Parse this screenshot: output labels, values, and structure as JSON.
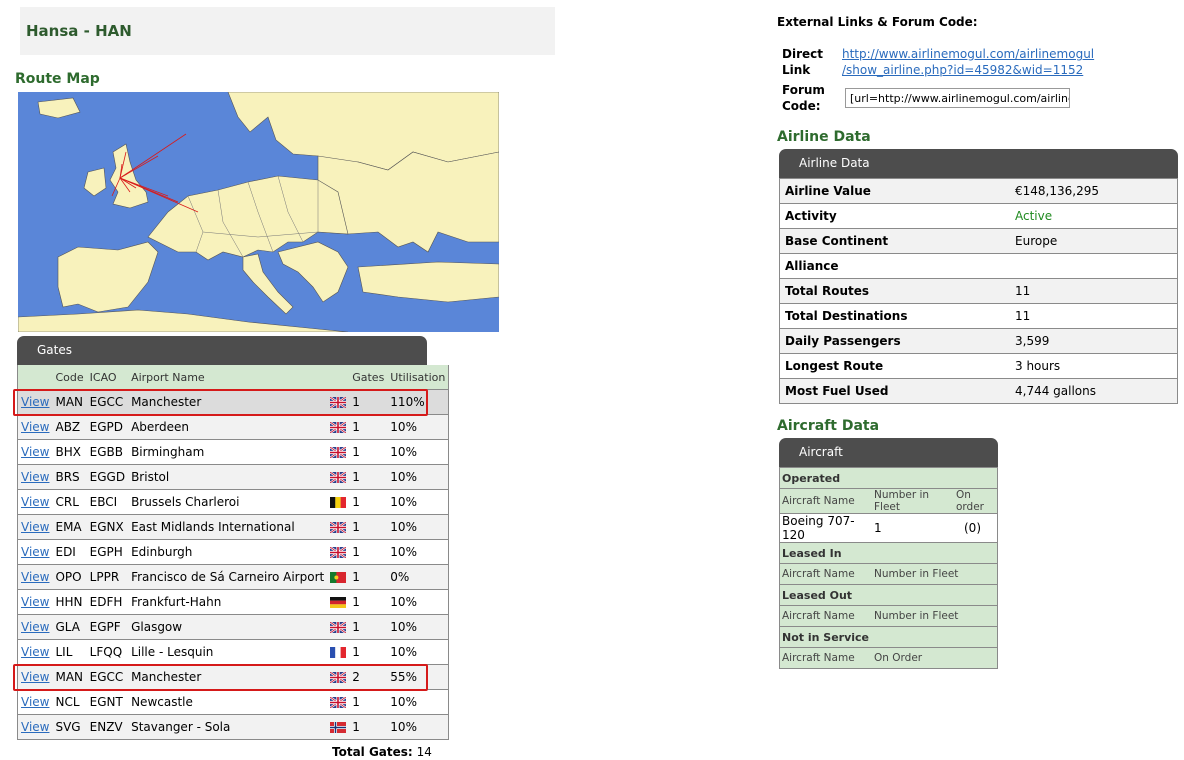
{
  "header": {
    "title": "Hansa - HAN"
  },
  "route_map": {
    "heading": "Route Map"
  },
  "gates": {
    "panel_title": "Gates",
    "columns": {
      "view": "",
      "code": "Code",
      "icao": "ICAO",
      "airport": "Airport Name",
      "flag": "",
      "gates": "Gates",
      "util": "Utilisation"
    },
    "rows": [
      {
        "view": "View",
        "code": "MAN",
        "icao": "EGCC",
        "airport": "Manchester",
        "flag": "uk-flag-icon",
        "gates": "1",
        "util": "110%"
      },
      {
        "view": "View",
        "code": "ABZ",
        "icao": "EGPD",
        "airport": "Aberdeen",
        "flag": "uk-flag-icon",
        "gates": "1",
        "util": "10%"
      },
      {
        "view": "View",
        "code": "BHX",
        "icao": "EGBB",
        "airport": "Birmingham",
        "flag": "uk-flag-icon",
        "gates": "1",
        "util": "10%"
      },
      {
        "view": "View",
        "code": "BRS",
        "icao": "EGGD",
        "airport": "Bristol",
        "flag": "uk-flag-icon",
        "gates": "1",
        "util": "10%"
      },
      {
        "view": "View",
        "code": "CRL",
        "icao": "EBCI",
        "airport": "Brussels Charleroi",
        "flag": "belgium-flag-icon",
        "gates": "1",
        "util": "10%"
      },
      {
        "view": "View",
        "code": "EMA",
        "icao": "EGNX",
        "airport": "East Midlands International",
        "flag": "uk-flag-icon",
        "gates": "1",
        "util": "10%"
      },
      {
        "view": "View",
        "code": "EDI",
        "icao": "EGPH",
        "airport": "Edinburgh",
        "flag": "uk-flag-icon",
        "gates": "1",
        "util": "10%"
      },
      {
        "view": "View",
        "code": "OPO",
        "icao": "LPPR",
        "airport": "Francisco de Sá Carneiro Airport",
        "flag": "portugal-flag-icon",
        "gates": "1",
        "util": "0%"
      },
      {
        "view": "View",
        "code": "HHN",
        "icao": "EDFH",
        "airport": "Frankfurt-Hahn",
        "flag": "germany-flag-icon",
        "gates": "1",
        "util": "10%"
      },
      {
        "view": "View",
        "code": "GLA",
        "icao": "EGPF",
        "airport": "Glasgow",
        "flag": "uk-flag-icon",
        "gates": "1",
        "util": "10%"
      },
      {
        "view": "View",
        "code": "LIL",
        "icao": "LFQQ",
        "airport": "Lille - Lesquin",
        "flag": "france-flag-icon",
        "gates": "1",
        "util": "10%"
      },
      {
        "view": "View",
        "code": "MAN",
        "icao": "EGCC",
        "airport": "Manchester",
        "flag": "uk-flag-icon",
        "gates": "2",
        "util": "55%"
      },
      {
        "view": "View",
        "code": "NCL",
        "icao": "EGNT",
        "airport": "Newcastle",
        "flag": "uk-flag-icon",
        "gates": "1",
        "util": "10%"
      },
      {
        "view": "View",
        "code": "SVG",
        "icao": "ENZV",
        "airport": "Stavanger - Sola",
        "flag": "norway-flag-icon",
        "gates": "1",
        "util": "10%"
      }
    ],
    "total_label": "Total Gates:",
    "total_value": "14"
  },
  "external": {
    "heading": "External Links & Forum Code:",
    "direct_label_1": "Direct",
    "direct_label_2": "Link",
    "link_line_1": "http://www.airlinemogul.com/airlinemogul",
    "link_line_2": "/show_airline.php?id=45982&wid=1152",
    "forum_label_1": "Forum",
    "forum_label_2": "Code:",
    "forum_value": "[url=http://www.airlinemogul.com/airlinemogu"
  },
  "airline_data": {
    "heading": "Airline Data",
    "panel_title": "Airline Data",
    "rows": [
      {
        "label": "Airline Value",
        "value": "€148,136,295"
      },
      {
        "label": "Activity",
        "value": "Active"
      },
      {
        "label": "Base Continent",
        "value": "Europe"
      },
      {
        "label": "Alliance",
        "value": ""
      },
      {
        "label": "Total Routes",
        "value": "11"
      },
      {
        "label": "Total Destinations",
        "value": "11"
      },
      {
        "label": "Daily Passengers",
        "value": "3,599"
      },
      {
        "label": "Longest Route",
        "value": "3 hours"
      },
      {
        "label": "Most Fuel Used",
        "value": "4,744 gallons"
      }
    ],
    "active_color": "#1f8a1f"
  },
  "aircraft_data": {
    "heading": "Aircraft Data",
    "panel_title": "Aircraft",
    "operated": "Operated",
    "op_col_name": "Aircraft Name",
    "op_col_fleet": "Number in Fleet",
    "op_col_order": "On order",
    "op_row": {
      "name": "Boeing 707-120",
      "fleet": "1",
      "order": "(0)"
    },
    "leased_in": "Leased In",
    "li_col_name": "Aircraft Name",
    "li_col_fleet": "Number in Fleet",
    "leased_out": "Leased Out",
    "lo_col_name": "Aircraft Name",
    "lo_col_fleet": "Number in Fleet",
    "not_in_service": "Not in Service",
    "nis_col_name": "Aircraft Name",
    "nis_col_order": "On Order"
  }
}
